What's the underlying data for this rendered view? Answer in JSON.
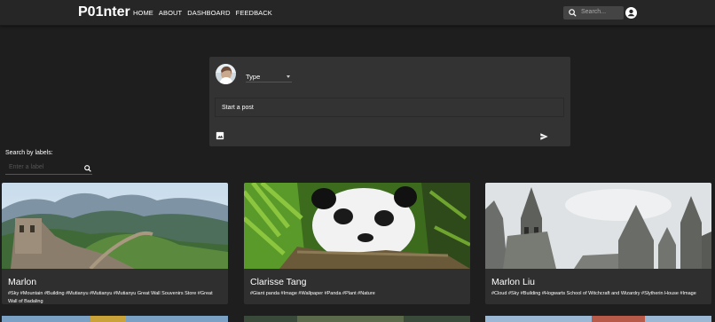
{
  "header": {
    "brand": "P01nter",
    "nav": [
      "HOME",
      "ABOUT",
      "DASHBOARD",
      "FEEDBACK"
    ],
    "search_placeholder": "Search..."
  },
  "composer": {
    "type_label": "Type",
    "post_placeholder": "Start a post"
  },
  "labels": {
    "title": "Search by labels:",
    "placeholder": "Enter a label"
  },
  "cards": [
    {
      "name": "Marlon",
      "tags": "#Sky #Mountain #Building #Mutianyu #Mutianyu #Mutianyu Great Wall Souvenirs Store #Great Wall of Badaling"
    },
    {
      "name": "Clarisse Tang",
      "tags": "#Giant panda #Image #Wallpaper #Panda #Plant #Nature"
    },
    {
      "name": "Marlon Liu",
      "tags": "#Cloud #Sky #Building #Hogwarts School of Witchcraft and Wizardry #Slytherin House #Image"
    }
  ],
  "colors": {
    "background": "#1e1e1e",
    "surface": "#333333",
    "card": "#2f2f2f",
    "topbar": "#262626"
  }
}
